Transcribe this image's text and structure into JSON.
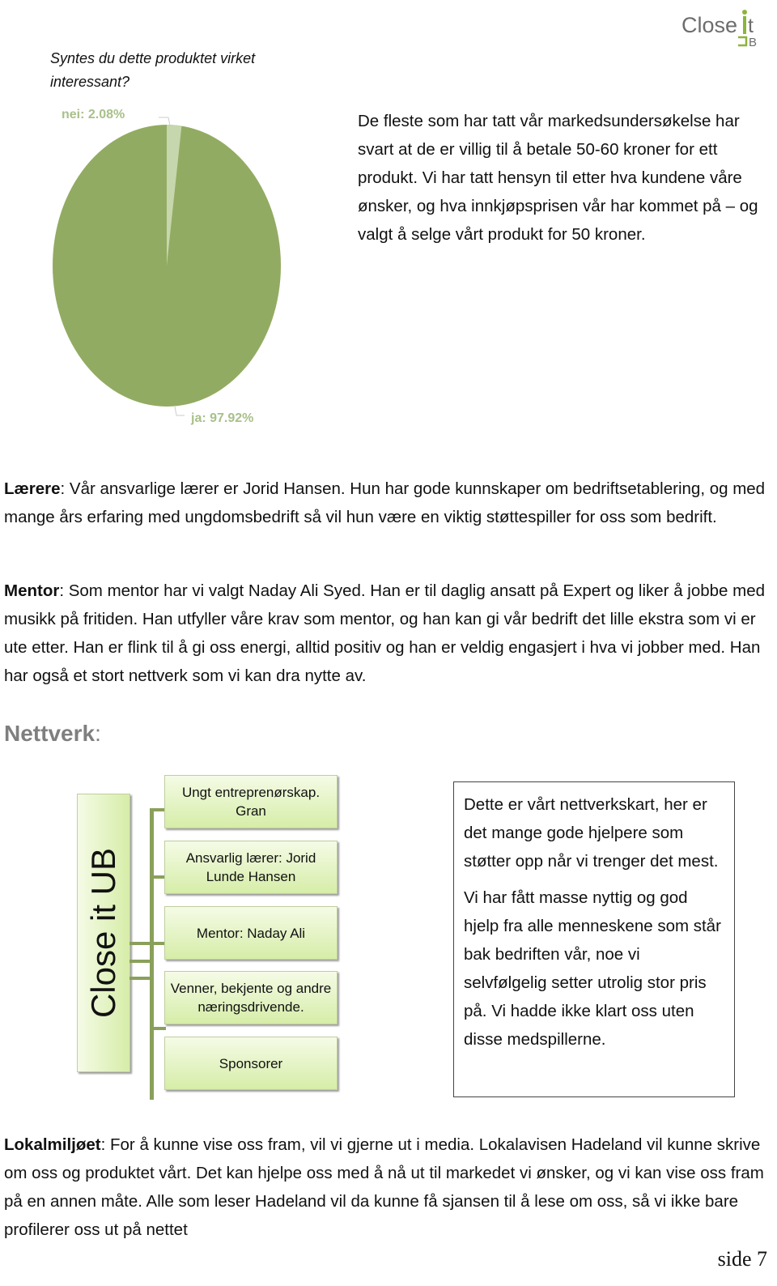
{
  "logo": {
    "text": "Close it UB",
    "colors": {
      "text": "#6d6d6d",
      "accent": "#8cb43c"
    }
  },
  "survey": {
    "question": "Syntes du dette produktet virket interessant?"
  },
  "chart_data": {
    "type": "pie",
    "title": "",
    "slices": [
      {
        "label": "nei",
        "value": 2.08,
        "display": "nei: 2.08%",
        "color": "#c6d6ad"
      },
      {
        "label": "ja",
        "value": 97.92,
        "display": "ja: 97.92%",
        "color": "#92ab62"
      }
    ]
  },
  "price_paragraph": "De fleste som har tatt vår markedsundersøkelse har svart at de er villig til å betale 50-60 kroner for ett produkt. Vi har tatt hensyn til etter hva kundene våre ønsker, og hva innkjøpsprisen vår har kommet på – og valgt å selge vårt produkt for 50 kroner.",
  "teacher": {
    "label": "Lærere",
    "text": ": Vår ansvarlige lærer er Jorid Hansen. Hun har gode kunnskaper om bedriftsetablering, og med mange års erfaring med ungdomsbedrift så vil hun være en viktig støttespiller for oss som bedrift."
  },
  "mentor": {
    "label": "Mentor",
    "text": ": Som mentor har vi valgt Naday Ali Syed. Han er til daglig ansatt på Expert og liker å jobbe med musikk på fritiden. Han utfyller våre krav som mentor, og han kan gi vår bedrift det lille ekstra som vi er ute etter. Han er flink til å gi oss energi, alltid positiv og han er veldig engasjert i hva vi jobber med.  Han har også et stort nettverk som vi kan dra nytte av."
  },
  "network": {
    "heading": "Nettverk",
    "colon": ":",
    "root": "Close it UB",
    "nodes": [
      "Ungt entreprenørskap. Gran",
      "Ansvarlig lærer: Jorid Lunde Hansen",
      "Mentor: Naday Ali",
      "Venner, bekjente og andre næringsdrivende.",
      "Sponsorer"
    ],
    "note": [
      "Dette er vårt nettverkskart, her er det mange gode hjelpere som støtter opp når vi trenger det mest.",
      "Vi har fått masse nyttig og god hjelp fra alle menneskene som står bak bedriften vår, noe vi selvfølgelig setter utrolig stor pris på. Vi hadde ikke klart oss uten disse medspillerne."
    ]
  },
  "local": {
    "label": "Lokalmiljøet",
    "text": ": For å kunne vise oss fram, vil vi gjerne ut i media. Lokalavisen Hadeland vil kunne skrive om oss og produktet vårt. Det kan hjelpe oss med å nå ut til markedet vi ønsker, og vi kan vise oss fram på en annen måte. Alle som leser Hadeland vil da kunne få sjansen til å lese om oss, så vi ikke bare profilerer oss ut på nettet"
  },
  "footer": {
    "page": "side 7"
  }
}
